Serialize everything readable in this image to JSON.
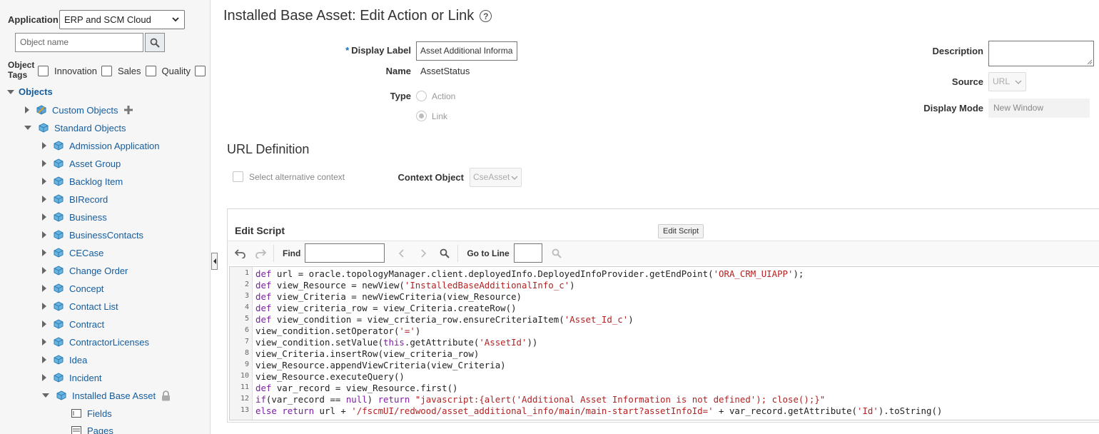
{
  "sidebar": {
    "application_label": "Application",
    "application_value": "ERP and SCM Cloud",
    "search_placeholder": "Object name",
    "tags_label": "Object Tags",
    "tags": [
      "Innovation",
      "Sales",
      "Quality"
    ],
    "objects_label": "Objects",
    "custom_objects": "Custom Objects",
    "standard_objects": "Standard Objects",
    "items": [
      "Admission Application",
      "Asset Group",
      "Backlog Item",
      "BIRecord",
      "Business",
      "BusinessContacts",
      "CECase",
      "Change Order",
      "Concept",
      "Contact List",
      "Contract",
      "ContractorLicenses",
      "Idea",
      "Incident",
      "Installed Base Asset"
    ],
    "sub_items": [
      "Fields",
      "Pages"
    ]
  },
  "page": {
    "title": "Installed Base Asset: Edit Action or Link",
    "help_icon": "?",
    "display_label_label": "Display Label",
    "display_label_value": "Asset Additional Informa",
    "name_label": "Name",
    "name_value": "AssetStatus",
    "type_label": "Type",
    "type_options": [
      "Action",
      "Link"
    ],
    "type_selected": "Link",
    "description_label": "Description",
    "source_label": "Source",
    "source_value": "URL",
    "display_mode_label": "Display Mode",
    "display_mode_value": "New Window",
    "url_section": "URL Definition",
    "alt_context_label": "Select alternative context",
    "context_object_label": "Context Object",
    "context_object_value": "CseAsset"
  },
  "editor": {
    "title": "Edit Script",
    "tooltip": "Edit Script",
    "find_label": "Find",
    "goto_label": "Go to Line",
    "line_numbers": [
      "1",
      "2",
      "3",
      "4",
      "5",
      "6",
      "7",
      "8",
      "9",
      "10",
      "11",
      "12",
      "13"
    ]
  }
}
